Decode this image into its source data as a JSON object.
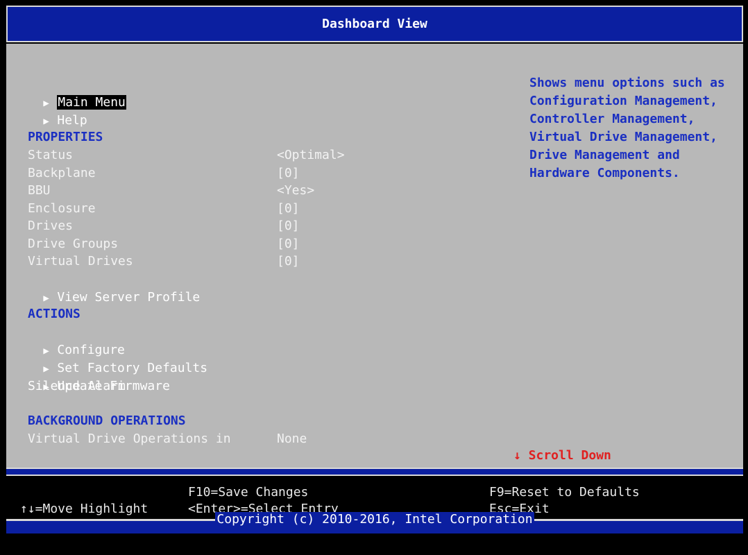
{
  "title": "Dashboard View",
  "nav": {
    "main_menu": "Main Menu",
    "help": "Help"
  },
  "properties": {
    "heading": "PROPERTIES",
    "items": [
      {
        "label": "Status",
        "value": "<Optimal>"
      },
      {
        "label": "Backplane",
        "value": "[0]"
      },
      {
        "label": "BBU",
        "value": "<Yes>"
      },
      {
        "label": "Enclosure",
        "value": "[0]"
      },
      {
        "label": "Drives",
        "value": "[0]"
      },
      {
        "label": "Drive Groups",
        "value": "[0]"
      },
      {
        "label": "Virtual Drives",
        "value": "[0]"
      }
    ],
    "view_server_profile": "View Server Profile"
  },
  "actions": {
    "heading": "ACTIONS",
    "configure": "Configure",
    "set_factory_defaults": "Set Factory Defaults",
    "update_firmware": "Update Firmware",
    "silence_alarm": "Silence Alarm"
  },
  "background_operations": {
    "heading": "BACKGROUND OPERATIONS",
    "label": "Virtual Drive Operations in",
    "value": "None"
  },
  "help_panel": {
    "lines": [
      "Shows menu options such as",
      "Configuration Management,",
      "Controller Management,",
      "Virtual Drive Management,",
      "Drive Management and",
      "Hardware Components."
    ]
  },
  "scroll_hint": "↓ Scroll Down",
  "footer": {
    "save": "F10=Save Changes",
    "reset": "F9=Reset to Defaults",
    "move": "↑↓=Move Highlight",
    "select": "<Enter>=Select Entry",
    "exit": "Esc=Exit",
    "copyright": "Copyright (c) 2010-2016, Intel Corporation"
  },
  "colors": {
    "title_bar": "#0b1fa0",
    "panel": "#b8b8b8",
    "heading": "#1a2fc2",
    "scroll_hint": "#e02020"
  }
}
